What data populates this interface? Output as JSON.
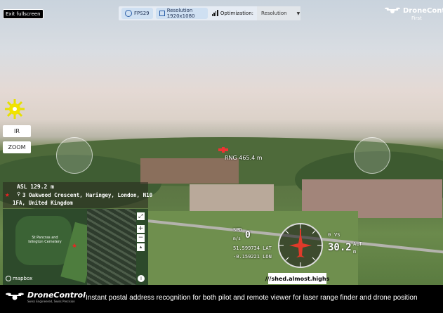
{
  "topbar": {
    "fps": "FPS29",
    "resolution": "Resolution 1920x1080",
    "optimization_label": "Optimization:",
    "optimization_value": "Resolution"
  },
  "exit_fullscreen": "Exit fullscreen",
  "brand": {
    "name": "DroneControl",
    "subtitle": "First Responder",
    "tagline": "Swiss Engineered, Swiss Precision"
  },
  "controls": {
    "ir": "IR",
    "zoom": "ZOOM"
  },
  "target": {
    "rng": "RNG 465.4 m"
  },
  "info": {
    "asl": "ASL 129.2 m",
    "address_line1": "3 Oakwood Crescent, Haringey, London, N10",
    "address_line2": "1FA, United Kingdom"
  },
  "map": {
    "label": "St Pancras and Islington Cemetery",
    "attribution": "mapbox",
    "zoom_in": "+",
    "zoom_out": "−"
  },
  "hud": {
    "spd_label": "SPD",
    "spd_value": "0",
    "spd_unit": "m/s",
    "lat": "51.599734 LAT",
    "lon": "-0.159221 LON",
    "vs_value": "0",
    "vs_label": "VS",
    "alt_value": "30.2",
    "alt_label": "ALT",
    "alt_unit": "m"
  },
  "what3words": "///shed.almost.highs",
  "footer_text": "Instant postal address recognition for both pilot and remote viewer for laser range finder and drone position"
}
